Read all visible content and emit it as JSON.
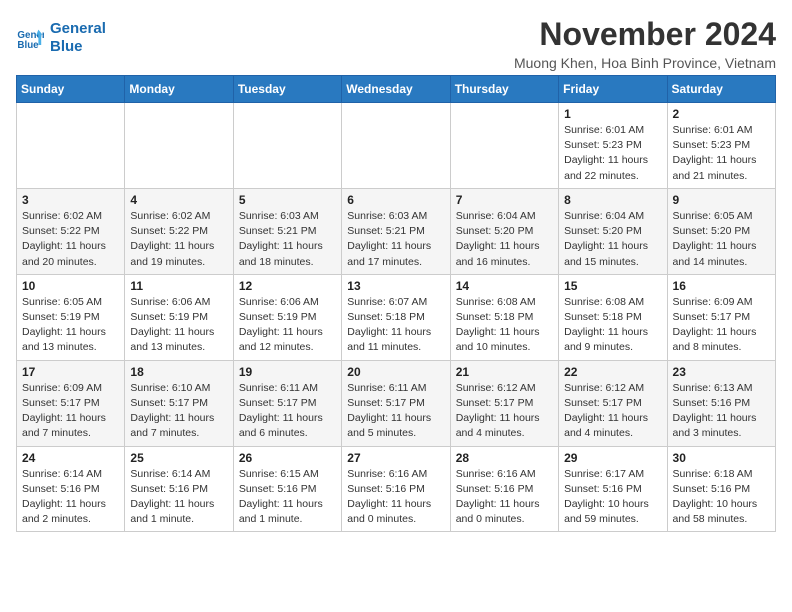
{
  "header": {
    "logo_line1": "General",
    "logo_line2": "Blue",
    "month_title": "November 2024",
    "location": "Muong Khen, Hoa Binh Province, Vietnam"
  },
  "weekdays": [
    "Sunday",
    "Monday",
    "Tuesday",
    "Wednesday",
    "Thursday",
    "Friday",
    "Saturday"
  ],
  "weeks": [
    [
      {
        "day": "",
        "info": ""
      },
      {
        "day": "",
        "info": ""
      },
      {
        "day": "",
        "info": ""
      },
      {
        "day": "",
        "info": ""
      },
      {
        "day": "",
        "info": ""
      },
      {
        "day": "1",
        "info": "Sunrise: 6:01 AM\nSunset: 5:23 PM\nDaylight: 11 hours\nand 22 minutes."
      },
      {
        "day": "2",
        "info": "Sunrise: 6:01 AM\nSunset: 5:23 PM\nDaylight: 11 hours\nand 21 minutes."
      }
    ],
    [
      {
        "day": "3",
        "info": "Sunrise: 6:02 AM\nSunset: 5:22 PM\nDaylight: 11 hours\nand 20 minutes."
      },
      {
        "day": "4",
        "info": "Sunrise: 6:02 AM\nSunset: 5:22 PM\nDaylight: 11 hours\nand 19 minutes."
      },
      {
        "day": "5",
        "info": "Sunrise: 6:03 AM\nSunset: 5:21 PM\nDaylight: 11 hours\nand 18 minutes."
      },
      {
        "day": "6",
        "info": "Sunrise: 6:03 AM\nSunset: 5:21 PM\nDaylight: 11 hours\nand 17 minutes."
      },
      {
        "day": "7",
        "info": "Sunrise: 6:04 AM\nSunset: 5:20 PM\nDaylight: 11 hours\nand 16 minutes."
      },
      {
        "day": "8",
        "info": "Sunrise: 6:04 AM\nSunset: 5:20 PM\nDaylight: 11 hours\nand 15 minutes."
      },
      {
        "day": "9",
        "info": "Sunrise: 6:05 AM\nSunset: 5:20 PM\nDaylight: 11 hours\nand 14 minutes."
      }
    ],
    [
      {
        "day": "10",
        "info": "Sunrise: 6:05 AM\nSunset: 5:19 PM\nDaylight: 11 hours\nand 13 minutes."
      },
      {
        "day": "11",
        "info": "Sunrise: 6:06 AM\nSunset: 5:19 PM\nDaylight: 11 hours\nand 13 minutes."
      },
      {
        "day": "12",
        "info": "Sunrise: 6:06 AM\nSunset: 5:19 PM\nDaylight: 11 hours\nand 12 minutes."
      },
      {
        "day": "13",
        "info": "Sunrise: 6:07 AM\nSunset: 5:18 PM\nDaylight: 11 hours\nand 11 minutes."
      },
      {
        "day": "14",
        "info": "Sunrise: 6:08 AM\nSunset: 5:18 PM\nDaylight: 11 hours\nand 10 minutes."
      },
      {
        "day": "15",
        "info": "Sunrise: 6:08 AM\nSunset: 5:18 PM\nDaylight: 11 hours\nand 9 minutes."
      },
      {
        "day": "16",
        "info": "Sunrise: 6:09 AM\nSunset: 5:17 PM\nDaylight: 11 hours\nand 8 minutes."
      }
    ],
    [
      {
        "day": "17",
        "info": "Sunrise: 6:09 AM\nSunset: 5:17 PM\nDaylight: 11 hours\nand 7 minutes."
      },
      {
        "day": "18",
        "info": "Sunrise: 6:10 AM\nSunset: 5:17 PM\nDaylight: 11 hours\nand 7 minutes."
      },
      {
        "day": "19",
        "info": "Sunrise: 6:11 AM\nSunset: 5:17 PM\nDaylight: 11 hours\nand 6 minutes."
      },
      {
        "day": "20",
        "info": "Sunrise: 6:11 AM\nSunset: 5:17 PM\nDaylight: 11 hours\nand 5 minutes."
      },
      {
        "day": "21",
        "info": "Sunrise: 6:12 AM\nSunset: 5:17 PM\nDaylight: 11 hours\nand 4 minutes."
      },
      {
        "day": "22",
        "info": "Sunrise: 6:12 AM\nSunset: 5:17 PM\nDaylight: 11 hours\nand 4 minutes."
      },
      {
        "day": "23",
        "info": "Sunrise: 6:13 AM\nSunset: 5:16 PM\nDaylight: 11 hours\nand 3 minutes."
      }
    ],
    [
      {
        "day": "24",
        "info": "Sunrise: 6:14 AM\nSunset: 5:16 PM\nDaylight: 11 hours\nand 2 minutes."
      },
      {
        "day": "25",
        "info": "Sunrise: 6:14 AM\nSunset: 5:16 PM\nDaylight: 11 hours\nand 1 minute."
      },
      {
        "day": "26",
        "info": "Sunrise: 6:15 AM\nSunset: 5:16 PM\nDaylight: 11 hours\nand 1 minute."
      },
      {
        "day": "27",
        "info": "Sunrise: 6:16 AM\nSunset: 5:16 PM\nDaylight: 11 hours\nand 0 minutes."
      },
      {
        "day": "28",
        "info": "Sunrise: 6:16 AM\nSunset: 5:16 PM\nDaylight: 11 hours\nand 0 minutes."
      },
      {
        "day": "29",
        "info": "Sunrise: 6:17 AM\nSunset: 5:16 PM\nDaylight: 10 hours\nand 59 minutes."
      },
      {
        "day": "30",
        "info": "Sunrise: 6:18 AM\nSunset: 5:16 PM\nDaylight: 10 hours\nand 58 minutes."
      }
    ]
  ]
}
